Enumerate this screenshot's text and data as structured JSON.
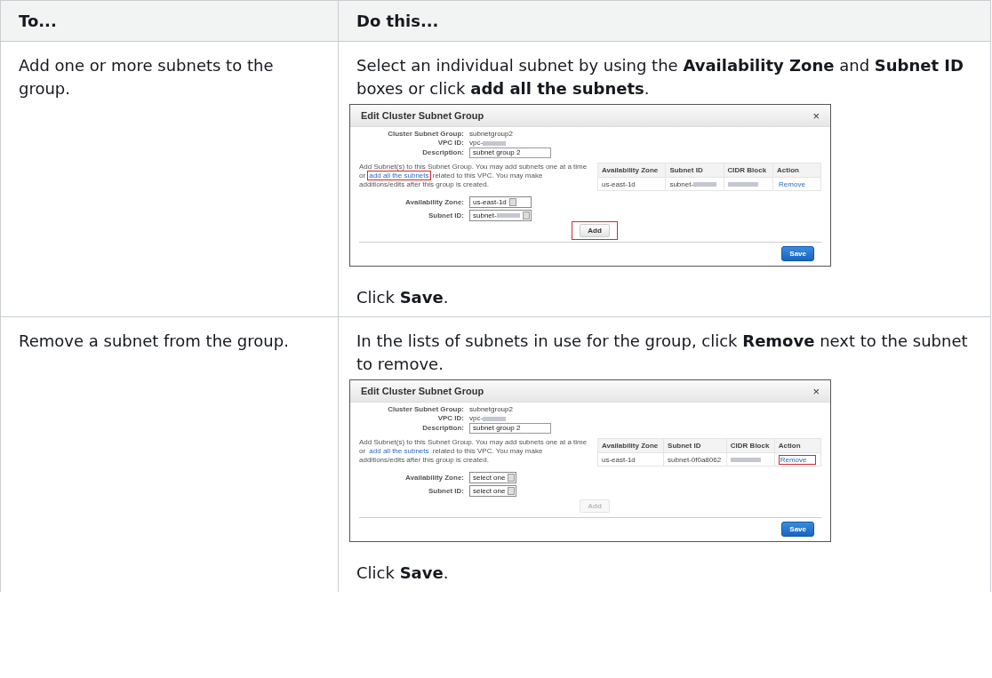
{
  "table": {
    "columns": [
      "To...",
      "Do this..."
    ],
    "rows": [
      {
        "task": "Add one or more subnets to the group.",
        "steps": [
          {
            "kind": "text",
            "text": "Select an individual subnet by using the **Availability Zone** and **Subnet ID** boxes or click **add all the subnets**."
          },
          {
            "kind": "dialog",
            "dialog": {
              "title": "Edit Cluster Subnet Group",
              "close": "×",
              "fields": [
                {
                  "kind": "text",
                  "label": "Cluster Subnet Group:",
                  "value": "subnetgroup2",
                  "redacted": false
                },
                {
                  "kind": "text",
                  "label": "VPC ID:",
                  "value": "vpc-",
                  "redacted": true
                },
                {
                  "kind": "input",
                  "label": "Description:",
                  "value": "subnet group 2",
                  "redacted": false
                }
              ],
              "note": {
                "before": "Add Subnet(s) to this Subnet Group. You may add subnets one at a time or",
                "link": "add all the subnets",
                "after": "related to this VPC. You may make additions/edits after this group is created.",
                "highlighted": true
              },
              "columns": [
                "Availability Zone",
                "Subnet ID",
                "CIDR Block",
                "Action"
              ],
              "rows": [
                {
                  "zone": "us-east-1d",
                  "subnet_id": "subnet-",
                  "subnet_redacted": true,
                  "cidr_redacted": true,
                  "action": "Remove",
                  "highlighted": false
                }
              ],
              "selects": [
                {
                  "label": "Availability Zone:",
                  "value": "us-east-1d",
                  "redacted": false
                },
                {
                  "label": "Subnet ID:",
                  "value": "subnet-",
                  "redacted": true
                }
              ],
              "add_button": {
                "label": "Add",
                "disabled": false,
                "highlighted": true
              },
              "save_button": "Save"
            }
          },
          {
            "kind": "text",
            "text": "Click **Save**."
          }
        ]
      },
      {
        "task": "Remove a subnet from the group.",
        "steps": [
          {
            "kind": "text",
            "text": "In the lists of subnets in use for the group, click **Remove** next to the subnet to remove."
          },
          {
            "kind": "dialog",
            "dialog": {
              "title": "Edit Cluster Subnet Group",
              "close": "×",
              "fields": [
                {
                  "kind": "text",
                  "label": "Cluster Subnet Group:",
                  "value": "subnetgroup2",
                  "redacted": false
                },
                {
                  "kind": "text",
                  "label": "VPC ID:",
                  "value": "vpc-",
                  "redacted": true
                },
                {
                  "kind": "input",
                  "label": "Description:",
                  "value": "subnet group 2",
                  "redacted": false
                }
              ],
              "note": {
                "before": "Add Subnet(s) to this Subnet Group. You may add subnets one at a time or",
                "link": "add all the subnets",
                "after": "related to this VPC. You may make additions/edits after this group is created.",
                "highlighted": false
              },
              "columns": [
                "Availability Zone",
                "Subnet ID",
                "CIDR Block",
                "Action"
              ],
              "rows": [
                {
                  "zone": "us-east-1d",
                  "subnet_id": "subnet-0f0a8062",
                  "subnet_redacted": false,
                  "cidr_redacted": true,
                  "action": "Remove",
                  "highlighted": true
                }
              ],
              "selects": [
                {
                  "label": "Availability Zone:",
                  "value": "select one",
                  "redacted": false
                },
                {
                  "label": "Subnet ID:",
                  "value": "select one",
                  "redacted": false
                }
              ],
              "add_button": {
                "label": "Add",
                "disabled": true,
                "highlighted": false
              },
              "save_button": "Save"
            }
          },
          {
            "kind": "text",
            "text": "Click **Save**."
          }
        ]
      }
    ]
  }
}
